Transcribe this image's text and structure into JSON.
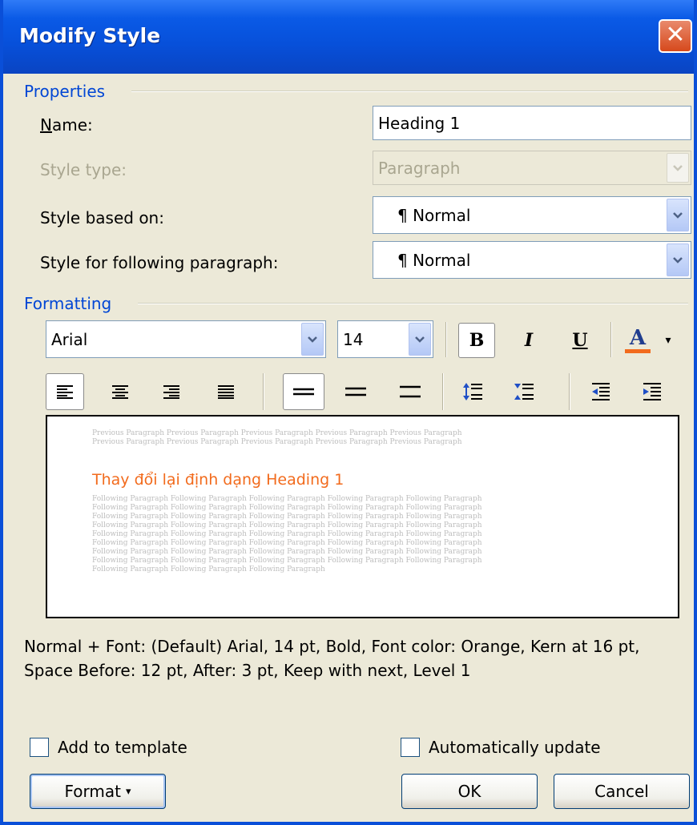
{
  "window": {
    "title": "Modify Style"
  },
  "properties": {
    "group_label": "Properties",
    "name_label": "Name:",
    "name_value": "Heading 1",
    "style_type_label": "Style type:",
    "style_type_value": "Paragraph",
    "based_on_label": "Style based on:",
    "based_on_value": "¶ Normal",
    "following_label": "Style for following paragraph:",
    "following_value": "¶ Normal"
  },
  "formatting": {
    "group_label": "Formatting",
    "font": "Arial",
    "size": "14",
    "bold_label": "B",
    "italic_label": "I",
    "underline_label": "U",
    "font_color_label": "A",
    "font_color": "#F26B1D"
  },
  "preview": {
    "previous_text": "Previous Paragraph Previous Paragraph Previous Paragraph Previous Paragraph Previous Paragraph",
    "heading_text": "Thay đổi lại định dạng Heading 1",
    "following_text": "Following Paragraph Following Paragraph Following Paragraph Following Paragraph Following Paragraph",
    "following_last": "Following Paragraph Following Paragraph Following Paragraph"
  },
  "description": "Normal + Font: (Default) Arial, 14 pt, Bold, Font color: Orange, Kern at 16 pt, Space Before:  12 pt, After:  3 pt, Keep with next, Level 1",
  "options": {
    "add_to_template": "Add to template",
    "auto_update": "Automatically update"
  },
  "buttons": {
    "format": "Format",
    "ok": "OK",
    "cancel": "Cancel"
  }
}
